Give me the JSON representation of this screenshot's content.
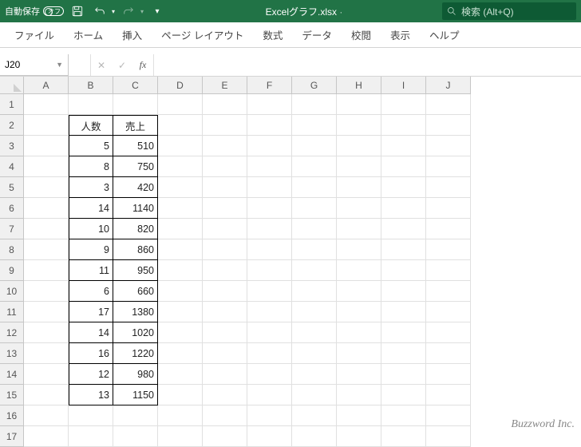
{
  "titlebar": {
    "autosave_label": "自動保存",
    "autosave_state": "オフ",
    "filename": "Excelグラフ.xlsx",
    "search_placeholder": "検索 (Alt+Q)"
  },
  "ribbon": {
    "tabs": [
      "ファイル",
      "ホーム",
      "挿入",
      "ページ レイアウト",
      "数式",
      "データ",
      "校閲",
      "表示",
      "ヘルプ"
    ]
  },
  "formula_bar": {
    "namebox": "J20",
    "fx_label": "fx",
    "formula": ""
  },
  "sheet": {
    "columns": [
      "A",
      "B",
      "C",
      "D",
      "E",
      "F",
      "G",
      "H",
      "I",
      "J"
    ],
    "row_numbers": [
      1,
      2,
      3,
      4,
      5,
      6,
      7,
      8,
      9,
      10,
      11,
      12,
      13,
      14,
      15,
      16,
      17
    ],
    "headers": {
      "b": "人数",
      "c": "売上"
    },
    "data": [
      {
        "b": "5",
        "c": "510"
      },
      {
        "b": "8",
        "c": "750"
      },
      {
        "b": "3",
        "c": "420"
      },
      {
        "b": "14",
        "c": "1140"
      },
      {
        "b": "10",
        "c": "820"
      },
      {
        "b": "9",
        "c": "860"
      },
      {
        "b": "11",
        "c": "950"
      },
      {
        "b": "6",
        "c": "660"
      },
      {
        "b": "17",
        "c": "1380"
      },
      {
        "b": "14",
        "c": "1020"
      },
      {
        "b": "16",
        "c": "1220"
      },
      {
        "b": "12",
        "c": "980"
      },
      {
        "b": "13",
        "c": "1150"
      }
    ]
  },
  "watermark": "Buzzword Inc."
}
